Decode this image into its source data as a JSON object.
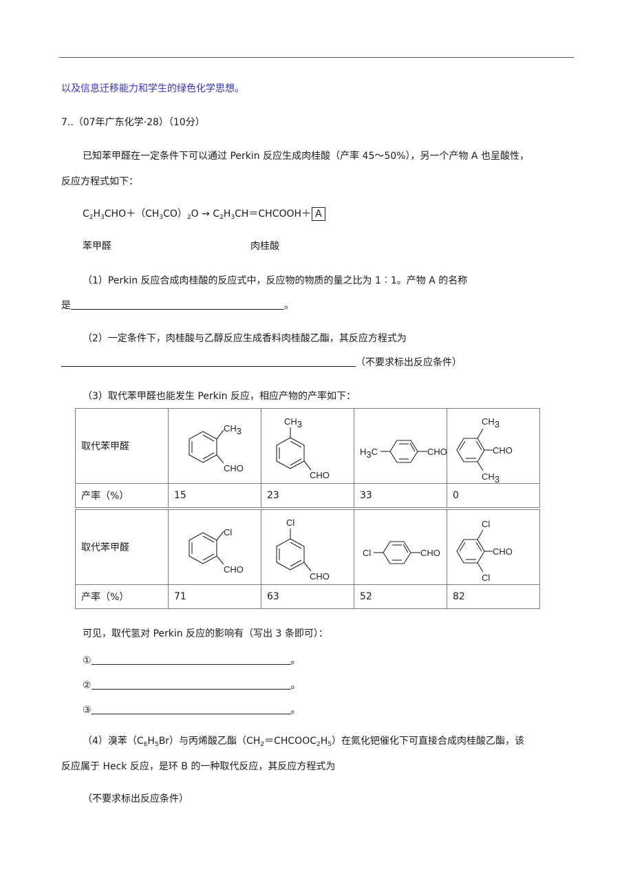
{
  "intro_line": "以及信息迁移能力和学生的绿色化学思想。",
  "question_header": "7..（07年广东化学·28）（10分）",
  "stem": {
    "line1": "已知苯甲醛在一定条件下可以通过 Perkin 反应生成肉桂酸（产率 45～50%），另一个产物 A 也呈酸性，",
    "line2": "反应方程式如下："
  },
  "equation": {
    "r1_a": "C",
    "r1_s1": "2",
    "r1_b": "H",
    "r1_s2": "3",
    "r1_c": "CHO＋（CH",
    "r1_s3": "3",
    "r1_d": "CO）",
    "r1_s4": "2",
    "r1_e": "O → C",
    "p1_s1": "2",
    "p1_b": "H",
    "p1_s2": "3",
    "p1_c": "CH＝CHCOOH＋",
    "product_a": "A"
  },
  "labels": {
    "benzaldehyde": "苯甲醛",
    "cinnamic_acid": "肉桂酸"
  },
  "part1": {
    "line1": "（1）Perkin 反应合成肉桂酸的反应式中，反应物的物质的量之比为 1︰1。产物 A 的名称",
    "prefix": "是",
    "suffix": "。"
  },
  "part2": {
    "line1": "（2）一定条件下，肉桂酸与乙醇反应生成香料肉桂酸乙酯，其反应方程式为",
    "note": "（不要求标出反应条件）"
  },
  "part3": {
    "intro": "（3）取代苯甲醛也能发生 Perkin 反应，相应产物的产率如下：",
    "row_label_structure": "取代苯甲醛",
    "row_label_yield": "产率（%）",
    "table1": [
      {
        "substituent": "2-CH3",
        "label_sub": "CH",
        "sub_num": "3",
        "cho": "CHO",
        "yield": "15"
      },
      {
        "substituent": "3-CH3",
        "label_sub": "CH",
        "sub_num": "3",
        "cho": "CHO",
        "yield": "23"
      },
      {
        "substituent": "4-CH3",
        "label_sub": "H",
        "sub_num": "3",
        "label_tail": "C",
        "cho": "CHO",
        "yield": "33"
      },
      {
        "substituent": "2,6-(CH3)2",
        "label_sub": "CH",
        "sub_num": "3",
        "cho": "CHO",
        "yield": "0"
      }
    ],
    "table2": [
      {
        "substituent": "2-Cl",
        "label_sub": "Cl",
        "cho": "CHO",
        "yield": "71"
      },
      {
        "substituent": "3-Cl",
        "label_sub": "Cl",
        "cho": "CHO",
        "yield": "63"
      },
      {
        "substituent": "4-Cl",
        "label_sub": "Cl",
        "cho": "CHO",
        "yield": "52"
      },
      {
        "substituent": "2,6-Cl2",
        "label_sub": "Cl",
        "cho": "CHO",
        "yield": "82"
      }
    ],
    "conclusion": "可见，取代氢对 Perkin 反应的影响有（写出 3 条即可）：",
    "answers": [
      {
        "marker": "①",
        "suffix": "。"
      },
      {
        "marker": "②",
        "suffix": "。"
      },
      {
        "marker": "③",
        "suffix": "。"
      }
    ]
  },
  "part4": {
    "line1_a": "（4）溴苯（C",
    "s1": "6",
    "line1_b": "H",
    "s2": "5",
    "line1_c": "Br）与丙烯酸乙酯（CH",
    "s3": "2",
    "line1_d": "＝CHCOOC",
    "s4": "2",
    "line1_e": "H",
    "s5": "5",
    "line1_f": "）在氮化钯催化下可直接合成肉桂酸乙酯，该",
    "line2": "反应属于 Heck 反应，是环 B 的一种取代反应，其反应方程式为",
    "note": "（不要求标出反应条件）"
  },
  "colors": {
    "intro_text": "#3333cc",
    "body_text": "#1a1a1a",
    "table_border": "#7a7a7a"
  }
}
